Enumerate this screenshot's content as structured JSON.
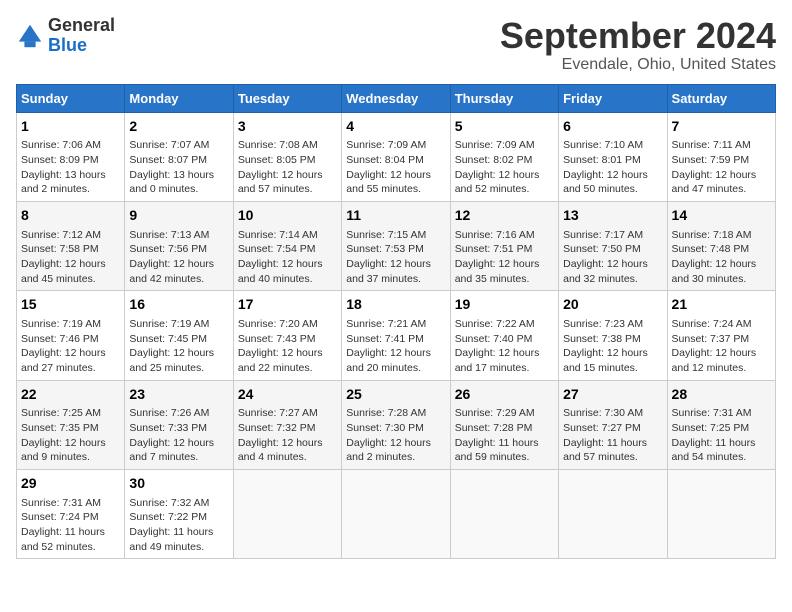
{
  "logo": {
    "general": "General",
    "blue": "Blue"
  },
  "title": "September 2024",
  "location": "Evendale, Ohio, United States",
  "days_of_week": [
    "Sunday",
    "Monday",
    "Tuesday",
    "Wednesday",
    "Thursday",
    "Friday",
    "Saturday"
  ],
  "weeks": [
    [
      {
        "day": "1",
        "sunrise": "7:06 AM",
        "sunset": "8:09 PM",
        "daylight": "13 hours and 2 minutes."
      },
      {
        "day": "2",
        "sunrise": "7:07 AM",
        "sunset": "8:07 PM",
        "daylight": "13 hours and 0 minutes."
      },
      {
        "day": "3",
        "sunrise": "7:08 AM",
        "sunset": "8:05 PM",
        "daylight": "12 hours and 57 minutes."
      },
      {
        "day": "4",
        "sunrise": "7:09 AM",
        "sunset": "8:04 PM",
        "daylight": "12 hours and 55 minutes."
      },
      {
        "day": "5",
        "sunrise": "7:09 AM",
        "sunset": "8:02 PM",
        "daylight": "12 hours and 52 minutes."
      },
      {
        "day": "6",
        "sunrise": "7:10 AM",
        "sunset": "8:01 PM",
        "daylight": "12 hours and 50 minutes."
      },
      {
        "day": "7",
        "sunrise": "7:11 AM",
        "sunset": "7:59 PM",
        "daylight": "12 hours and 47 minutes."
      }
    ],
    [
      {
        "day": "8",
        "sunrise": "7:12 AM",
        "sunset": "7:58 PM",
        "daylight": "12 hours and 45 minutes."
      },
      {
        "day": "9",
        "sunrise": "7:13 AM",
        "sunset": "7:56 PM",
        "daylight": "12 hours and 42 minutes."
      },
      {
        "day": "10",
        "sunrise": "7:14 AM",
        "sunset": "7:54 PM",
        "daylight": "12 hours and 40 minutes."
      },
      {
        "day": "11",
        "sunrise": "7:15 AM",
        "sunset": "7:53 PM",
        "daylight": "12 hours and 37 minutes."
      },
      {
        "day": "12",
        "sunrise": "7:16 AM",
        "sunset": "7:51 PM",
        "daylight": "12 hours and 35 minutes."
      },
      {
        "day": "13",
        "sunrise": "7:17 AM",
        "sunset": "7:50 PM",
        "daylight": "12 hours and 32 minutes."
      },
      {
        "day": "14",
        "sunrise": "7:18 AM",
        "sunset": "7:48 PM",
        "daylight": "12 hours and 30 minutes."
      }
    ],
    [
      {
        "day": "15",
        "sunrise": "7:19 AM",
        "sunset": "7:46 PM",
        "daylight": "12 hours and 27 minutes."
      },
      {
        "day": "16",
        "sunrise": "7:19 AM",
        "sunset": "7:45 PM",
        "daylight": "12 hours and 25 minutes."
      },
      {
        "day": "17",
        "sunrise": "7:20 AM",
        "sunset": "7:43 PM",
        "daylight": "12 hours and 22 minutes."
      },
      {
        "day": "18",
        "sunrise": "7:21 AM",
        "sunset": "7:41 PM",
        "daylight": "12 hours and 20 minutes."
      },
      {
        "day": "19",
        "sunrise": "7:22 AM",
        "sunset": "7:40 PM",
        "daylight": "12 hours and 17 minutes."
      },
      {
        "day": "20",
        "sunrise": "7:23 AM",
        "sunset": "7:38 PM",
        "daylight": "12 hours and 15 minutes."
      },
      {
        "day": "21",
        "sunrise": "7:24 AM",
        "sunset": "7:37 PM",
        "daylight": "12 hours and 12 minutes."
      }
    ],
    [
      {
        "day": "22",
        "sunrise": "7:25 AM",
        "sunset": "7:35 PM",
        "daylight": "12 hours and 9 minutes."
      },
      {
        "day": "23",
        "sunrise": "7:26 AM",
        "sunset": "7:33 PM",
        "daylight": "12 hours and 7 minutes."
      },
      {
        "day": "24",
        "sunrise": "7:27 AM",
        "sunset": "7:32 PM",
        "daylight": "12 hours and 4 minutes."
      },
      {
        "day": "25",
        "sunrise": "7:28 AM",
        "sunset": "7:30 PM",
        "daylight": "12 hours and 2 minutes."
      },
      {
        "day": "26",
        "sunrise": "7:29 AM",
        "sunset": "7:28 PM",
        "daylight": "11 hours and 59 minutes."
      },
      {
        "day": "27",
        "sunrise": "7:30 AM",
        "sunset": "7:27 PM",
        "daylight": "11 hours and 57 minutes."
      },
      {
        "day": "28",
        "sunrise": "7:31 AM",
        "sunset": "7:25 PM",
        "daylight": "11 hours and 54 minutes."
      }
    ],
    [
      {
        "day": "29",
        "sunrise": "7:31 AM",
        "sunset": "7:24 PM",
        "daylight": "11 hours and 52 minutes."
      },
      {
        "day": "30",
        "sunrise": "7:32 AM",
        "sunset": "7:22 PM",
        "daylight": "11 hours and 49 minutes."
      },
      null,
      null,
      null,
      null,
      null
    ]
  ]
}
